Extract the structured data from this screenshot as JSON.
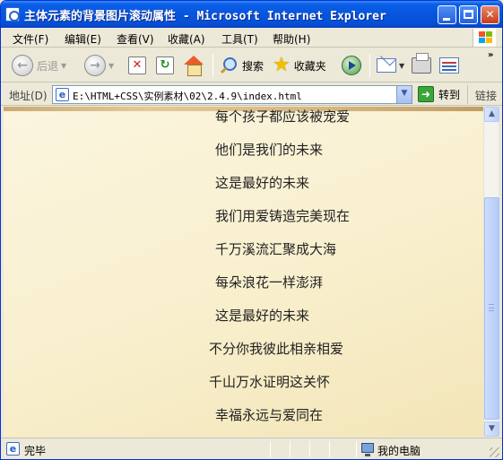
{
  "window": {
    "title": "主体元素的背景图片滚动属性 - Microsoft Internet Explorer"
  },
  "title_buttons": {
    "minimize": "",
    "maximize": "",
    "close": "✕"
  },
  "menu": {
    "items": [
      {
        "label": "文件(F)"
      },
      {
        "label": "编辑(E)"
      },
      {
        "label": "查看(V)"
      },
      {
        "label": "收藏(A)"
      },
      {
        "label": "工具(T)"
      },
      {
        "label": "帮助(H)"
      }
    ]
  },
  "toolbar": {
    "back_label": "后退",
    "search_label": "搜索",
    "favorites_label": "收藏夹",
    "more": "»"
  },
  "address": {
    "label": "地址(D)",
    "value": "E:\\HTML+CSS\\实例素材\\02\\2.4.9\\index.html",
    "go_label": "转到",
    "links_label": "链接"
  },
  "content": {
    "lines": [
      "每个孩子都应该被宠爱",
      "他们是我们的未来",
      "这是最好的未来",
      "我们用爱铸造完美现在",
      "千万溪流汇聚成大海",
      "每朵浪花一样澎湃",
      "这是最好的未来",
      "不分你我彼此相亲相爱",
      "千山万水证明这关怀",
      "幸福永远与爱同在"
    ]
  },
  "status": {
    "text": "完毕",
    "zone": "我的电脑"
  },
  "colors": {
    "titlebar": "#0855dd",
    "content_bg": "#f8efcd",
    "chrome": "#ece9d8"
  }
}
